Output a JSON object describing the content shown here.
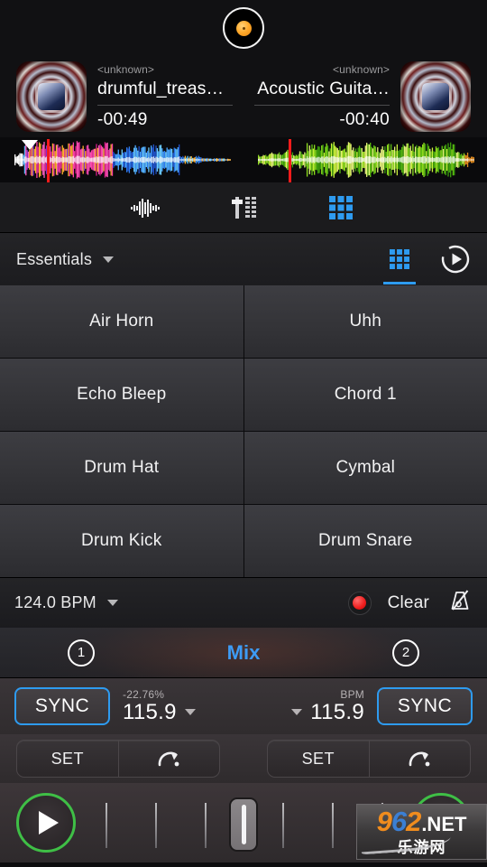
{
  "app": {
    "logo_icon": "vinyl-record-icon"
  },
  "decks": {
    "left": {
      "artwork_icon": "album-art",
      "artist": "<unknown>",
      "title": "drumful_treas…",
      "time_remaining": "-00:49",
      "waveform_icon": "waveform-left",
      "deck_number": "1",
      "sync_label": "SYNC",
      "pitch_percent": "-22.76%",
      "bpm_value": "115.9",
      "bpm_caption": "",
      "set_label": "SET",
      "cue_icon": "cue-jump-icon",
      "play_icon": "play-icon"
    },
    "right": {
      "artwork_icon": "album-art",
      "artist": "<unknown>",
      "title": "Acoustic Guita…",
      "time_remaining": "-00:40",
      "waveform_icon": "waveform-right",
      "deck_number": "2",
      "sync_label": "SYNC",
      "pitch_percent": "",
      "bpm_value": "115.9",
      "bpm_caption": "BPM",
      "set_label": "SET",
      "cue_icon": "cue-jump-icon",
      "play_icon": "play-icon"
    }
  },
  "mode_toolbar": {
    "items": [
      {
        "icon": "waveform-icon",
        "active": false
      },
      {
        "icon": "mixer-sliders-icon",
        "active": false
      },
      {
        "icon": "grid-pads-icon",
        "active": true
      }
    ]
  },
  "sampler": {
    "bank_name": "Essentials",
    "bank_chevron_icon": "chevron-down-icon",
    "grid_tab_icon": "grid-pads-icon",
    "play_tab_icon": "play-circle-icon",
    "pads": [
      {
        "label": "Air Horn"
      },
      {
        "label": "Uhh"
      },
      {
        "label": "Echo Bleep"
      },
      {
        "label": "Chord 1"
      },
      {
        "label": "Drum Hat"
      },
      {
        "label": "Cymbal"
      },
      {
        "label": "Drum Kick"
      },
      {
        "label": "Drum Snare"
      }
    ]
  },
  "bpm_bar": {
    "bpm_text": "124.0 BPM",
    "chevron_icon": "chevron-down-icon",
    "record_icon": "record-icon",
    "clear_label": "Clear",
    "metronome_icon": "metronome-off-icon"
  },
  "mix_bar": {
    "label": "Mix"
  },
  "crossfader": {
    "handle_icon": "crossfader-handle",
    "position_percent": 50,
    "tick_count": 6
  },
  "watermark": {
    "text_9": "9",
    "text_6": "6",
    "text_2": "2",
    "text_net": ".NET",
    "text_cn": "乐游网"
  },
  "colors": {
    "accent_blue": "#2e9bf0",
    "mix_blue": "#3d9bf5",
    "play_green": "#3fbf46",
    "record_red": "#ee1c1c",
    "playhead_red": "#f31b1b",
    "background": "#0d0d0f"
  }
}
